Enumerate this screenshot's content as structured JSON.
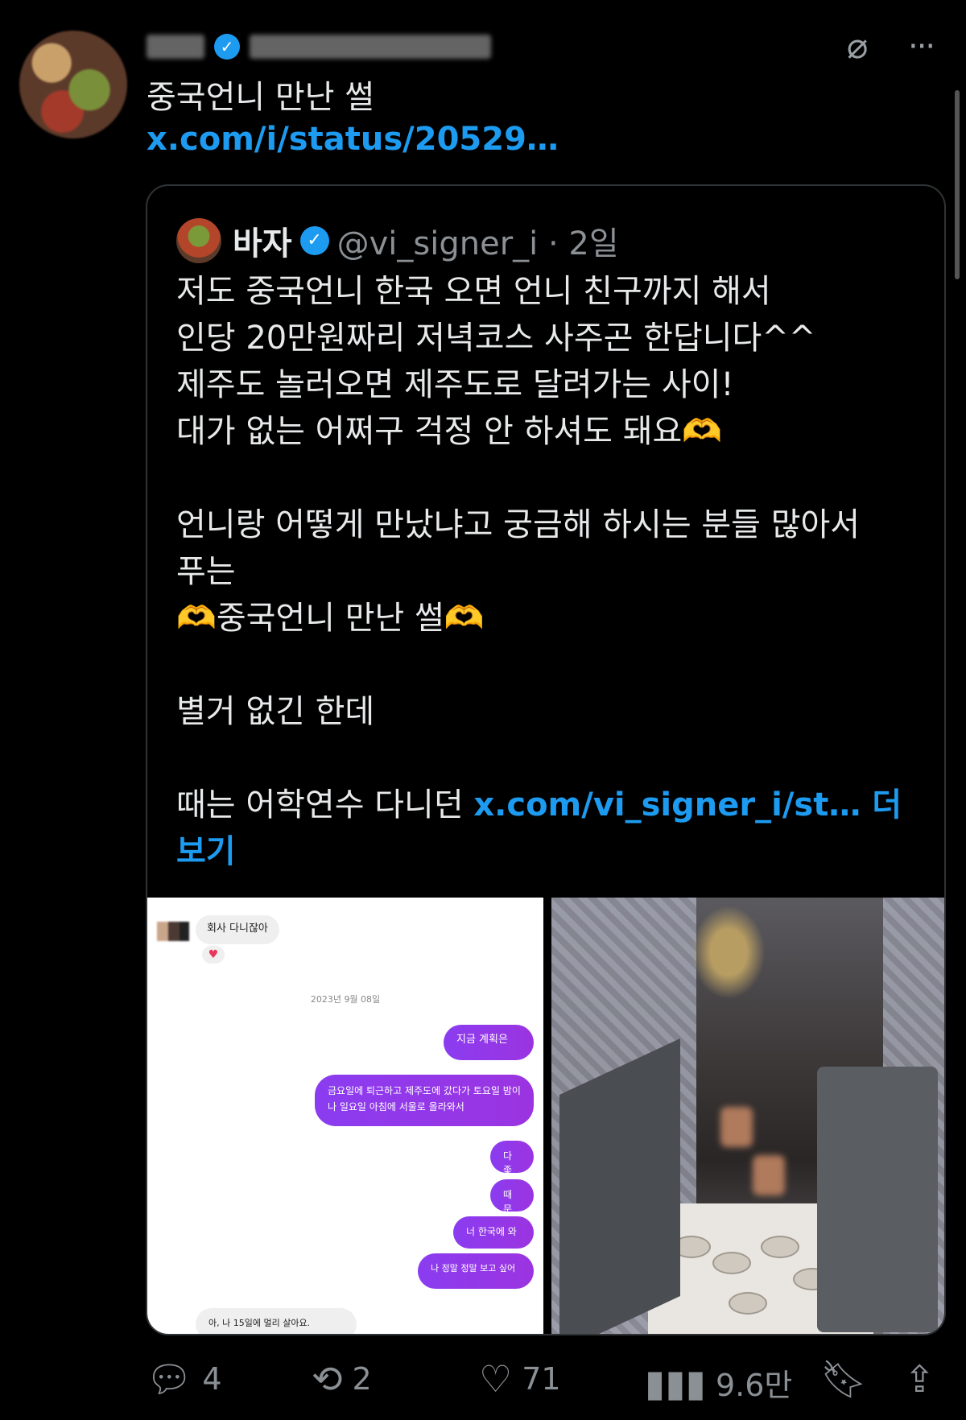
{
  "post": {
    "text": "중국언니 만난 썰",
    "link": "x.com/i/status/20529…"
  },
  "quote": {
    "name": "바자",
    "handle": "@vi_signer_i · 2일",
    "body": {
      "line1": "저도 중국언니 한국 오면 언니 친구까지 해서",
      "line2": "인당 20만원짜리 저녁코스 사주곤 한답니다^^",
      "line3": "제주도 놀러오면 제주도로 달려가는 사이!",
      "line4": "대가 없는 어쩌구 걱정 안 하셔도 돼요",
      "line5": "언니랑 어떻게 만났냐고 궁금해 하시는 분들 많아서",
      "line6": "푸는",
      "line7": "중국언니 만난 썰",
      "line8": "별거 없긴 한데",
      "line9_prefix": "때는 어학연수 다니던 ",
      "line9_link": "x.com/vi_signer_i/st… 더",
      "line10_link": "보기"
    }
  },
  "chat": {
    "in_msg1": "회사 다니잖아",
    "date": "2023년 9월 08일",
    "out_msg1": "지금 계획은",
    "out_msg2": "금요일에 퇴근하고 제주도에 갔다가 토요일 밤이나 일요일 아침에 서울로 올라와서",
    "out_msg3": "다 좋다",
    "out_msg4": "때문에",
    "out_msg5": "너 한국에 와",
    "out_msg6": "나 정말 정말 보고 싶어",
    "in_msg2": "아, 나 15일에 멀리 살아요."
  },
  "actions": {
    "replies": "4",
    "reposts": "2",
    "likes": "71",
    "views": "9.6만"
  },
  "icons": {
    "verified": "verified-badge-icon",
    "grok": "grok-icon",
    "more": "more-icon",
    "reply": "reply-icon",
    "repost": "repost-icon",
    "like": "heart-icon",
    "views": "views-icon",
    "bookmark": "bookmark-icon",
    "share": "share-icon"
  },
  "colors": {
    "background": "#000000",
    "link": "#1d9bf0",
    "muted": "#8b9095",
    "chat_bubble": "#8b3cf0"
  }
}
